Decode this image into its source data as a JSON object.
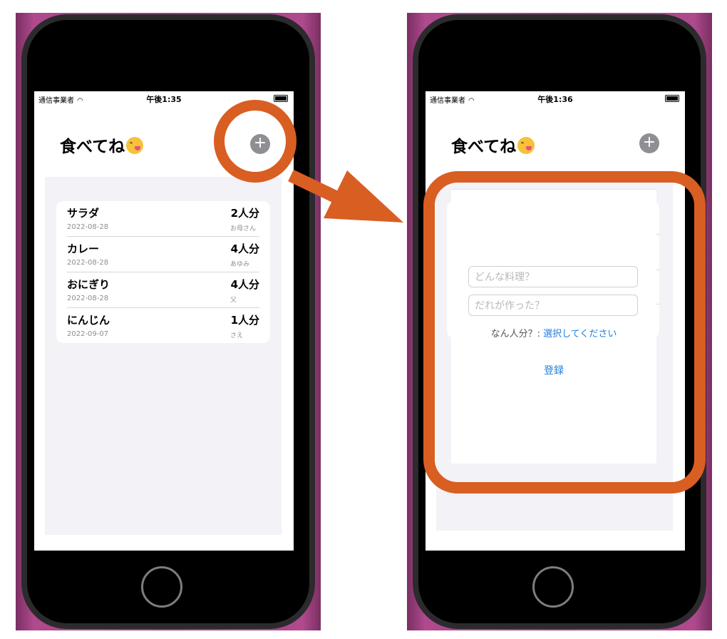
{
  "left_phone": {
    "status": {
      "carrier": "通信事業者",
      "time": "午後1:35"
    },
    "title": "食べてね",
    "add_button": "+",
    "dishes": [
      {
        "name": "サラダ",
        "date": "2022-08-28",
        "servings": "2人分",
        "cook": "お母さん"
      },
      {
        "name": "カレー",
        "date": "2022-08-28",
        "servings": "4人分",
        "cook": "あゆみ"
      },
      {
        "name": "おにぎり",
        "date": "2022-08-28",
        "servings": "4人分",
        "cook": "父"
      },
      {
        "name": "にんじん",
        "date": "2022-09-07",
        "servings": "1人分",
        "cook": "さえ"
      }
    ]
  },
  "right_phone": {
    "status": {
      "carrier": "通信事業者",
      "time": "午後1:36"
    },
    "title": "食べてね",
    "add_button": "+",
    "form": {
      "dish_placeholder": "どんな料理？",
      "cook_placeholder": "だれが作った？",
      "servings_label": "なん人分？:",
      "servings_value": "選択してください",
      "register_label": "登録"
    }
  },
  "colors": {
    "highlight": "#d95e22",
    "accent": "#1f7de0",
    "device": "#9c3d7c"
  }
}
